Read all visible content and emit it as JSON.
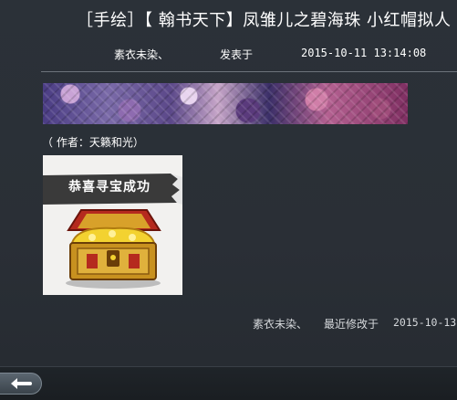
{
  "post": {
    "title": "［手绘］【 翰书天下】凤雏儿之碧海珠  小红帽拟人",
    "author": "素衣未染、",
    "posted_label": "发表于",
    "posted_at": "2015-10-11  13:14:08",
    "credit": "（ 作者：天籁和光）",
    "image_caption": "恭喜寻宝成功"
  },
  "footer": {
    "author": "素衣未染、",
    "modified_label": "最近修改于",
    "modified_at": "2015-10-13"
  },
  "colors": {
    "background": "#2b3138",
    "text": "#ffffff",
    "muted_text": "#d6d9dc",
    "divider": "#6c737b"
  },
  "icons": {
    "back": "back-arrow-icon"
  }
}
